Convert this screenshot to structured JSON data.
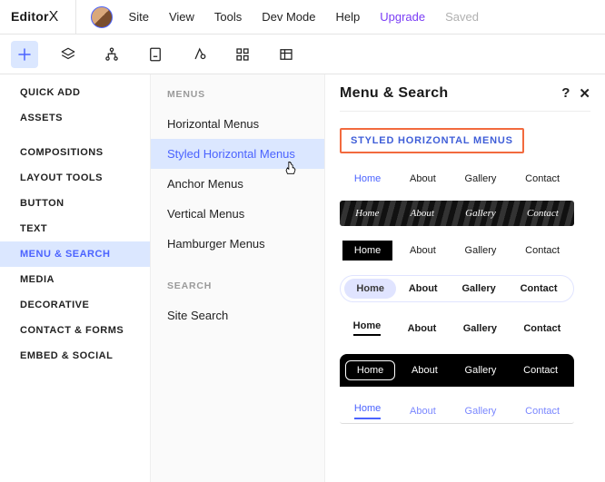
{
  "logo": {
    "text": "Editor",
    "x": "X"
  },
  "topmenu": {
    "site": "Site",
    "view": "View",
    "tools": "Tools",
    "devmode": "Dev Mode",
    "help": "Help",
    "upgrade": "Upgrade",
    "saved": "Saved"
  },
  "sidebar": {
    "items": [
      {
        "label": "QUICK ADD"
      },
      {
        "label": "ASSETS"
      },
      {
        "label": "COMPOSITIONS"
      },
      {
        "label": "LAYOUT TOOLS"
      },
      {
        "label": "BUTTON"
      },
      {
        "label": "TEXT"
      },
      {
        "label": "MENU & SEARCH"
      },
      {
        "label": "MEDIA"
      },
      {
        "label": "DECORATIVE"
      },
      {
        "label": "CONTACT & FORMS"
      },
      {
        "label": "EMBED & SOCIAL"
      }
    ]
  },
  "subcol": {
    "head_menus": "MENUS",
    "items": [
      "Horizontal Menus",
      "Styled Horizontal Menus",
      "Anchor Menus",
      "Vertical Menus",
      "Hamburger Menus"
    ],
    "head_search": "SEARCH",
    "search_item": "Site Search"
  },
  "panel": {
    "title": "Menu & Search",
    "help": "?",
    "close": "✕",
    "section_label": "STYLED HORIZONTAL MENUS",
    "menu_items": [
      "Home",
      "About",
      "Gallery",
      "Contact"
    ]
  }
}
